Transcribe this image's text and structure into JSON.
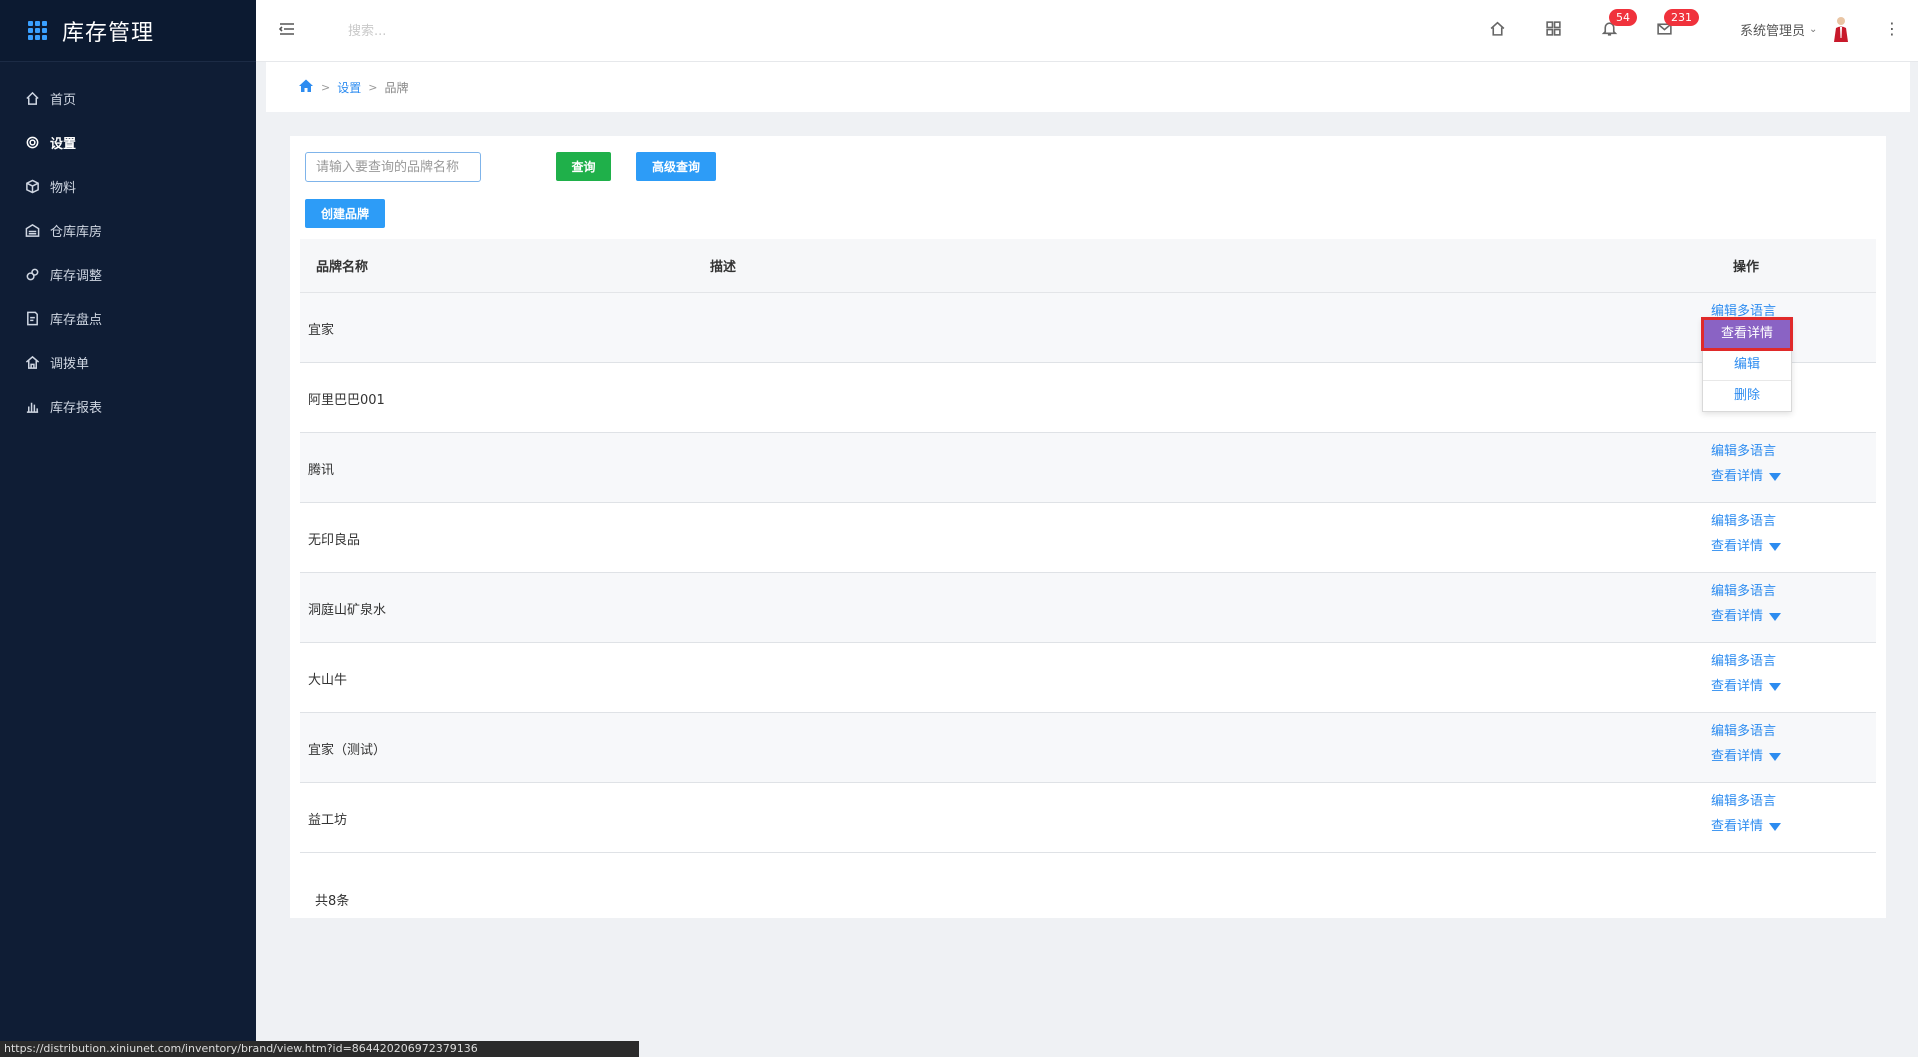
{
  "app": {
    "title": "库存管理"
  },
  "sidebar": {
    "items": [
      {
        "label": "首页",
        "icon": "home-icon"
      },
      {
        "label": "设置",
        "icon": "gear-icon",
        "active": true
      },
      {
        "label": "物料",
        "icon": "cube-icon"
      },
      {
        "label": "仓库库房",
        "icon": "warehouse-icon"
      },
      {
        "label": "库存调整",
        "icon": "adjust-icon"
      },
      {
        "label": "库存盘点",
        "icon": "checklist-icon"
      },
      {
        "label": "调拨单",
        "icon": "transfer-icon"
      },
      {
        "label": "库存报表",
        "icon": "bar-chart-icon"
      }
    ]
  },
  "header": {
    "search_placeholder": "搜索...",
    "notifications_count": "54",
    "messages_count": "231",
    "user_name": "系统管理员"
  },
  "breadcrumb": {
    "level1": "设置",
    "level2": "品牌",
    "sep": ">"
  },
  "toolbar": {
    "query_placeholder": "请输入要查询的品牌名称",
    "query_button": "查询",
    "advanced_button": "高级查询",
    "create_button": "创建品牌"
  },
  "table": {
    "headers": {
      "name": "品牌名称",
      "desc": "描述",
      "ops": "操作"
    },
    "rows": [
      {
        "name": "宜家",
        "desc": ""
      },
      {
        "name": "阿里巴巴001",
        "desc": ""
      },
      {
        "name": "腾讯",
        "desc": ""
      },
      {
        "name": "无印良品",
        "desc": ""
      },
      {
        "name": "洞庭山矿泉水",
        "desc": ""
      },
      {
        "name": "大山牛",
        "desc": ""
      },
      {
        "name": "宜家（测试）",
        "desc": ""
      },
      {
        "name": "益工坊",
        "desc": ""
      }
    ],
    "op_lang": "编辑多语言",
    "op_detail": "查看详情"
  },
  "dropdown": {
    "detail": "查看详情",
    "edit": "编辑",
    "delete": "删除"
  },
  "footer": {
    "total": "共8条"
  },
  "statusbar": {
    "url": "https://distribution.xiniunet.com/inventory/brand/view.htm?id=864420206972379136"
  },
  "colors": {
    "sidebar_bg": "#0f1d35",
    "accent": "#2d8cf0",
    "green": "#1fb04a",
    "badge": "#f0323c",
    "dropdown_highlight": "#8a63c4"
  }
}
